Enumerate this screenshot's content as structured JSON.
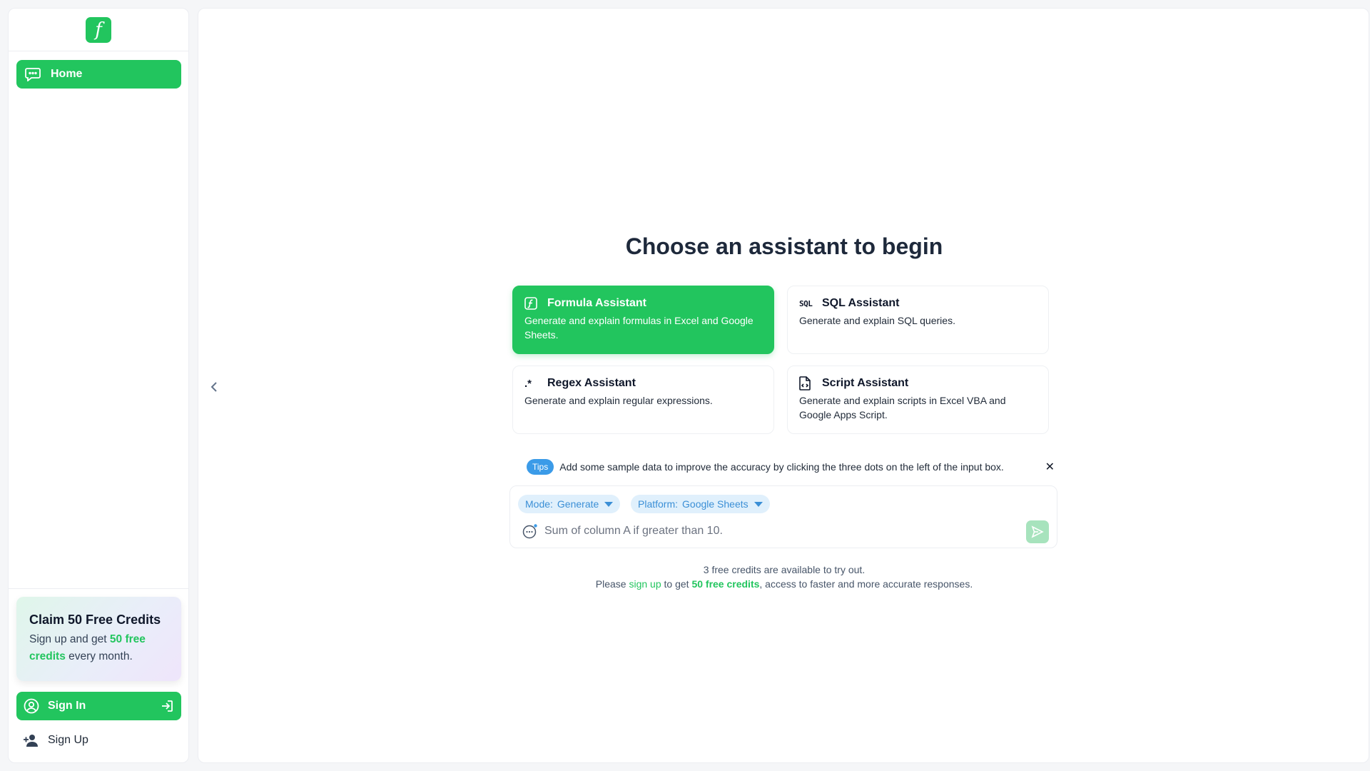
{
  "sidebar": {
    "logo_glyph": "f",
    "nav": [
      {
        "label": "Home",
        "icon": "chat-icon"
      }
    ],
    "promo": {
      "title": "Claim 50 Free Credits",
      "text_before": "Sign up and get ",
      "highlight": "50 free credits",
      "text_after": " every month."
    },
    "signin_label": "Sign In",
    "signup_label": "Sign Up"
  },
  "main": {
    "heading": "Choose an assistant to begin",
    "assistants": [
      {
        "title": "Formula Assistant",
        "desc": "Generate and explain formulas in Excel and Google Sheets.",
        "icon": "formula-icon",
        "active": true
      },
      {
        "title": "SQL Assistant",
        "desc": "Generate and explain SQL queries.",
        "icon": "sql-icon",
        "icon_text": "SQL",
        "active": false
      },
      {
        "title": "Regex Assistant",
        "desc": "Generate and explain regular expressions.",
        "icon": "regex-icon",
        "icon_text": ".*",
        "active": false
      },
      {
        "title": "Script Assistant",
        "desc": "Generate and explain scripts in Excel VBA and Google Apps Script.",
        "icon": "script-icon",
        "active": false
      }
    ],
    "tips": {
      "badge": "Tips",
      "text": "Add some sample data to improve the accuracy by clicking the three dots on the left of the input box.",
      "close": "✕"
    },
    "input": {
      "mode_key": "Mode:",
      "mode_value": "Generate",
      "platform_key": "Platform:",
      "platform_value": "Google Sheets",
      "placeholder": "Sum of column A if greater than 10."
    },
    "footnote": {
      "line1": "3 free credits are available to try out.",
      "please": "Please ",
      "signup_link": "sign up",
      "to_get": " to get ",
      "credits_bold": "50 free credits",
      "rest": ", access to faster and more accurate responses."
    }
  },
  "colors": {
    "accent": "#22c55e",
    "chip_bg": "#e0f0fc",
    "chip_text": "#3b8fd6",
    "tips_badge": "#3b9be8",
    "send_disabled": "#a7e3bd"
  }
}
